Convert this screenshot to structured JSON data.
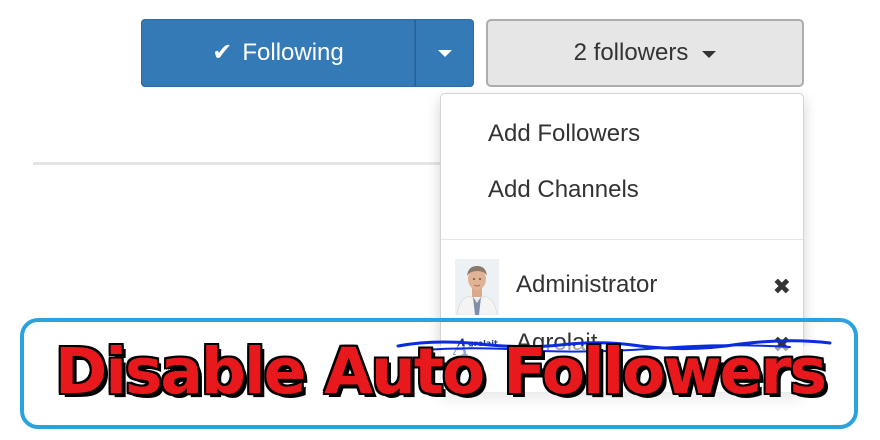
{
  "follow": {
    "following_label": "Following",
    "followers_label": "2 followers"
  },
  "dropdown": {
    "add_followers": "Add Followers",
    "add_channels": "Add Channels",
    "followers": [
      {
        "name": "Administrator",
        "avatar": "person-avatar"
      },
      {
        "name": "Agrolait",
        "avatar": "agrolait-logo",
        "logo_text": "grolait"
      }
    ],
    "remove_glyph": "✖"
  },
  "overlay": {
    "banner_text": "Disable Auto Followers",
    "text_color": "#e8191c",
    "frame_color": "#29a3e0",
    "scribble_color": "#0a2be0"
  }
}
